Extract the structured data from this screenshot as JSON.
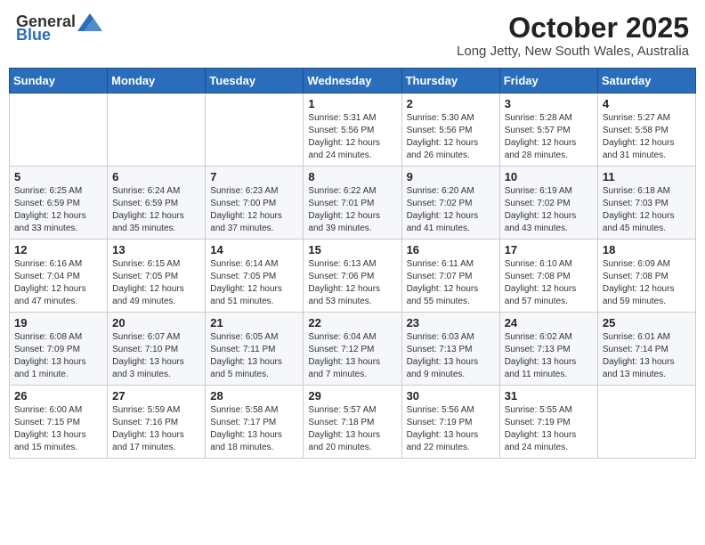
{
  "header": {
    "logo": {
      "general": "General",
      "blue": "Blue"
    },
    "month": "October 2025",
    "location": "Long Jetty, New South Wales, Australia"
  },
  "weekdays": [
    "Sunday",
    "Monday",
    "Tuesday",
    "Wednesday",
    "Thursday",
    "Friday",
    "Saturday"
  ],
  "weeks": [
    [
      {
        "day": "",
        "info": ""
      },
      {
        "day": "",
        "info": ""
      },
      {
        "day": "",
        "info": ""
      },
      {
        "day": "1",
        "info": "Sunrise: 5:31 AM\nSunset: 5:56 PM\nDaylight: 12 hours\nand 24 minutes."
      },
      {
        "day": "2",
        "info": "Sunrise: 5:30 AM\nSunset: 5:56 PM\nDaylight: 12 hours\nand 26 minutes."
      },
      {
        "day": "3",
        "info": "Sunrise: 5:28 AM\nSunset: 5:57 PM\nDaylight: 12 hours\nand 28 minutes."
      },
      {
        "day": "4",
        "info": "Sunrise: 5:27 AM\nSunset: 5:58 PM\nDaylight: 12 hours\nand 31 minutes."
      }
    ],
    [
      {
        "day": "5",
        "info": "Sunrise: 6:25 AM\nSunset: 6:59 PM\nDaylight: 12 hours\nand 33 minutes."
      },
      {
        "day": "6",
        "info": "Sunrise: 6:24 AM\nSunset: 6:59 PM\nDaylight: 12 hours\nand 35 minutes."
      },
      {
        "day": "7",
        "info": "Sunrise: 6:23 AM\nSunset: 7:00 PM\nDaylight: 12 hours\nand 37 minutes."
      },
      {
        "day": "8",
        "info": "Sunrise: 6:22 AM\nSunset: 7:01 PM\nDaylight: 12 hours\nand 39 minutes."
      },
      {
        "day": "9",
        "info": "Sunrise: 6:20 AM\nSunset: 7:02 PM\nDaylight: 12 hours\nand 41 minutes."
      },
      {
        "day": "10",
        "info": "Sunrise: 6:19 AM\nSunset: 7:02 PM\nDaylight: 12 hours\nand 43 minutes."
      },
      {
        "day": "11",
        "info": "Sunrise: 6:18 AM\nSunset: 7:03 PM\nDaylight: 12 hours\nand 45 minutes."
      }
    ],
    [
      {
        "day": "12",
        "info": "Sunrise: 6:16 AM\nSunset: 7:04 PM\nDaylight: 12 hours\nand 47 minutes."
      },
      {
        "day": "13",
        "info": "Sunrise: 6:15 AM\nSunset: 7:05 PM\nDaylight: 12 hours\nand 49 minutes."
      },
      {
        "day": "14",
        "info": "Sunrise: 6:14 AM\nSunset: 7:05 PM\nDaylight: 12 hours\nand 51 minutes."
      },
      {
        "day": "15",
        "info": "Sunrise: 6:13 AM\nSunset: 7:06 PM\nDaylight: 12 hours\nand 53 minutes."
      },
      {
        "day": "16",
        "info": "Sunrise: 6:11 AM\nSunset: 7:07 PM\nDaylight: 12 hours\nand 55 minutes."
      },
      {
        "day": "17",
        "info": "Sunrise: 6:10 AM\nSunset: 7:08 PM\nDaylight: 12 hours\nand 57 minutes."
      },
      {
        "day": "18",
        "info": "Sunrise: 6:09 AM\nSunset: 7:08 PM\nDaylight: 12 hours\nand 59 minutes."
      }
    ],
    [
      {
        "day": "19",
        "info": "Sunrise: 6:08 AM\nSunset: 7:09 PM\nDaylight: 13 hours\nand 1 minute."
      },
      {
        "day": "20",
        "info": "Sunrise: 6:07 AM\nSunset: 7:10 PM\nDaylight: 13 hours\nand 3 minutes."
      },
      {
        "day": "21",
        "info": "Sunrise: 6:05 AM\nSunset: 7:11 PM\nDaylight: 13 hours\nand 5 minutes."
      },
      {
        "day": "22",
        "info": "Sunrise: 6:04 AM\nSunset: 7:12 PM\nDaylight: 13 hours\nand 7 minutes."
      },
      {
        "day": "23",
        "info": "Sunrise: 6:03 AM\nSunset: 7:13 PM\nDaylight: 13 hours\nand 9 minutes."
      },
      {
        "day": "24",
        "info": "Sunrise: 6:02 AM\nSunset: 7:13 PM\nDaylight: 13 hours\nand 11 minutes."
      },
      {
        "day": "25",
        "info": "Sunrise: 6:01 AM\nSunset: 7:14 PM\nDaylight: 13 hours\nand 13 minutes."
      }
    ],
    [
      {
        "day": "26",
        "info": "Sunrise: 6:00 AM\nSunset: 7:15 PM\nDaylight: 13 hours\nand 15 minutes."
      },
      {
        "day": "27",
        "info": "Sunrise: 5:59 AM\nSunset: 7:16 PM\nDaylight: 13 hours\nand 17 minutes."
      },
      {
        "day": "28",
        "info": "Sunrise: 5:58 AM\nSunset: 7:17 PM\nDaylight: 13 hours\nand 18 minutes."
      },
      {
        "day": "29",
        "info": "Sunrise: 5:57 AM\nSunset: 7:18 PM\nDaylight: 13 hours\nand 20 minutes."
      },
      {
        "day": "30",
        "info": "Sunrise: 5:56 AM\nSunset: 7:19 PM\nDaylight: 13 hours\nand 22 minutes."
      },
      {
        "day": "31",
        "info": "Sunrise: 5:55 AM\nSunset: 7:19 PM\nDaylight: 13 hours\nand 24 minutes."
      },
      {
        "day": "",
        "info": ""
      }
    ]
  ]
}
